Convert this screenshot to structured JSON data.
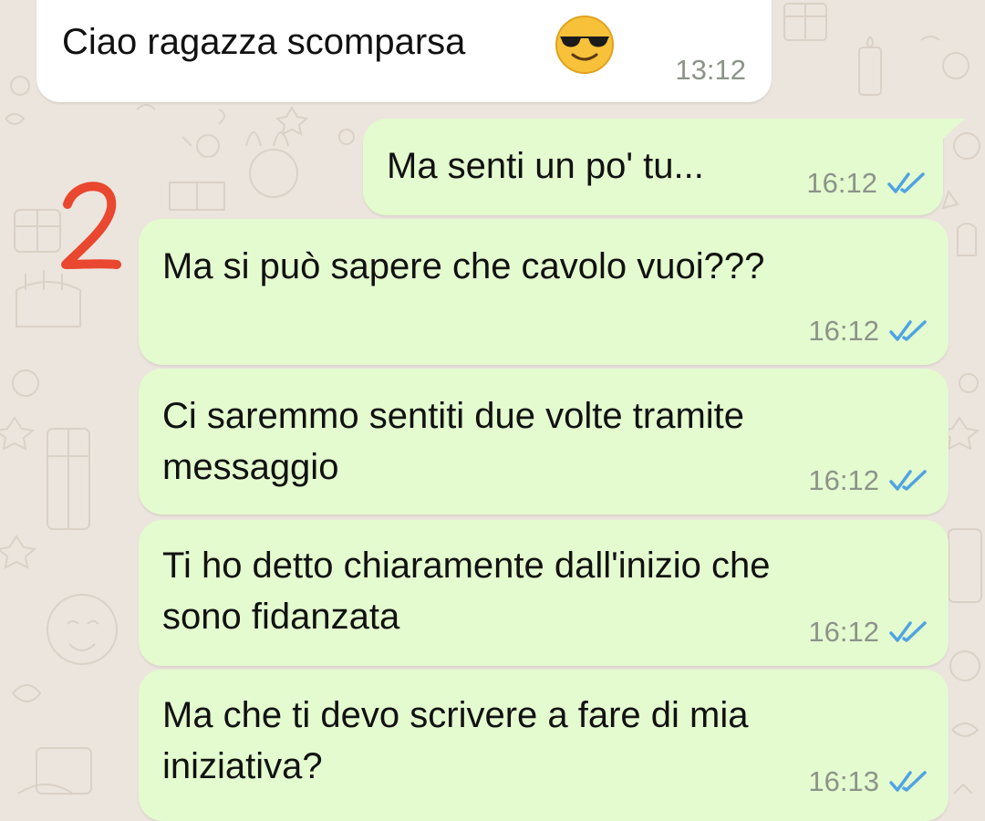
{
  "colors": {
    "background": "#ece5dd",
    "incoming_bubble": "#ffffff",
    "outgoing_bubble": "#e3fbcf",
    "timestamp": "#8c9489",
    "read_receipt": "#4fa3e3",
    "annotation": "#e9472f"
  },
  "annotation": {
    "label": "2"
  },
  "messages": [
    {
      "direction": "incoming",
      "text": "Ciao ragazza scomparsa",
      "emoji": "😎",
      "emoji_icon": "smiling-face-with-sunglasses-icon",
      "time": "13:12"
    },
    {
      "direction": "outgoing",
      "text": "Ma senti un po' tu...",
      "time": "16:12",
      "status_icon": "double-check-read-icon"
    },
    {
      "direction": "outgoing",
      "text": "Ma si può sapere che cavolo vuoi???",
      "time": "16:12",
      "status_icon": "double-check-read-icon"
    },
    {
      "direction": "outgoing",
      "text": "Ci saremmo sentiti due volte tramite\nmessaggio",
      "time": "16:12",
      "status_icon": "double-check-read-icon"
    },
    {
      "direction": "outgoing",
      "text": "Ti ho detto chiaramente dall'inizio che\nsono fidanzata",
      "time": "16:12",
      "status_icon": "double-check-read-icon"
    },
    {
      "direction": "outgoing",
      "text": "Ma che ti devo scrivere a fare di mia\niniziativa?",
      "time": "16:13",
      "status_icon": "double-check-read-icon"
    }
  ]
}
